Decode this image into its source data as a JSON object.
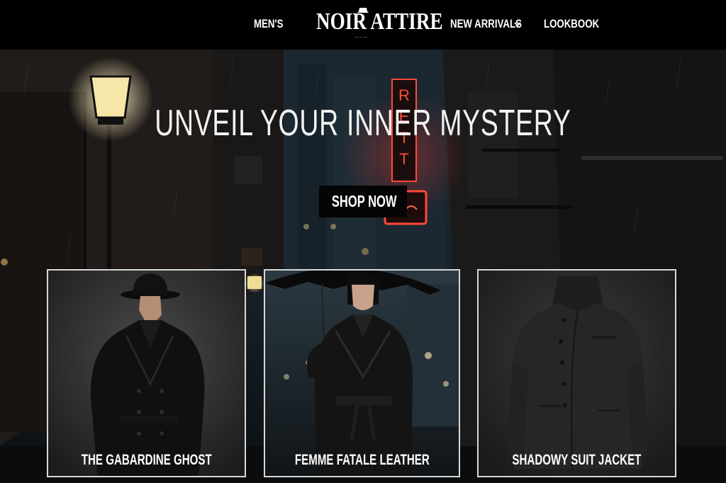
{
  "nav": {
    "mens": "MEN'S",
    "brand": "NOIR ATTIRE",
    "new_arrivals": "NEW ARRIVALS",
    "lookbook": "LOOKBOOK"
  },
  "hero": {
    "headline": "UNVEIL  YOUR INNER MYSTERY",
    "cta": "SHOP NOW"
  },
  "products": [
    {
      "name": "THE GABARDINE GHOST"
    },
    {
      "name": "FEMME FATALE LEATHER"
    },
    {
      "name": "SHADOWY SUIT JACKET"
    }
  ],
  "colors": {
    "nav_bg": "#000000",
    "neon": "#ff3b2f",
    "card_border": "#d8d8d8"
  },
  "icons": [
    "chevron-down-icon"
  ]
}
